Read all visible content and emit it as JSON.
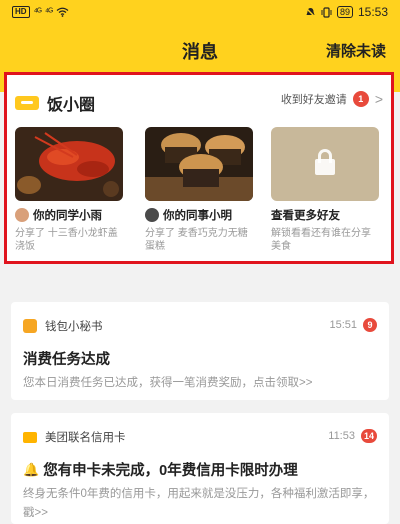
{
  "status_bar": {
    "hd": "HD",
    "signal1": "⁴ᴳ",
    "signal2": "⁴ᴳ",
    "battery": "89",
    "time": "15:53"
  },
  "nav": {
    "title": "消息",
    "action": "清除未读"
  },
  "fan_circle": {
    "title": "饭小圈",
    "invite_text": "收到好友邀请",
    "invite_count": "1",
    "friends": [
      {
        "name": "你的同学小雨",
        "desc": "分享了 十三香小龙虾盖浇饭"
      },
      {
        "name": "你的同事小明",
        "desc": "分享了 麦香巧克力无糖蛋糕"
      },
      {
        "name": "查看更多好友",
        "desc": "解锁看看还有谁在分享美食"
      }
    ]
  },
  "messages": [
    {
      "app": "钱包小秘书",
      "time": "15:51",
      "count": "9",
      "title": "消费任务达成",
      "body": "您本日消费任务已达成，获得一笔消费奖励，点击领取>>"
    },
    {
      "app": "美团联名信用卡",
      "time": "11:53",
      "count": "14",
      "title": "您有申卡未完成，0年费信用卡限时办理",
      "body": "终身无条件0年费的信用卡，用起来就是没压力，各种福利激活即享，戳>>"
    }
  ],
  "colors": {
    "brand_yellow": "#ffd21e",
    "highlight_red": "#e0141e",
    "badge_red": "#e84a3c"
  }
}
